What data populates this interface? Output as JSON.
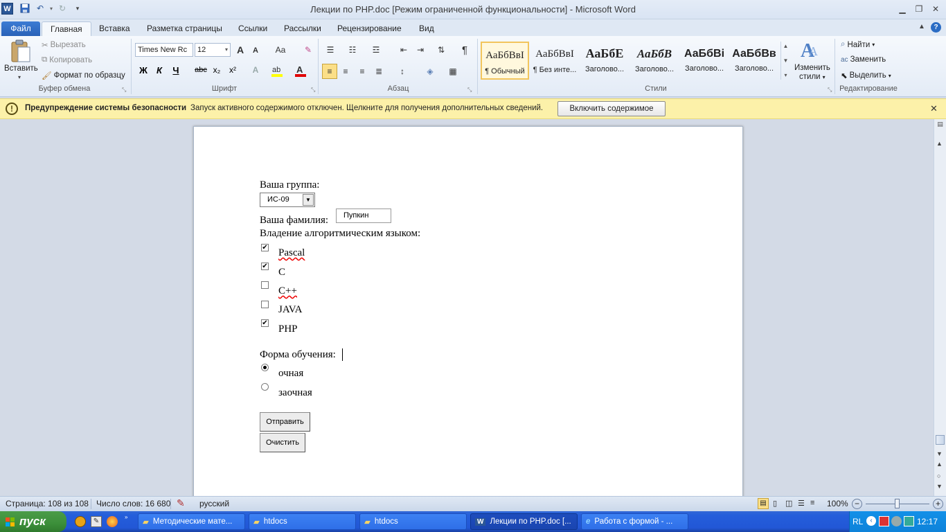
{
  "window": {
    "title": "Лекции по PHP.doc [Режим ограниченной функциональности]  -  Microsoft Word",
    "word_icon": "W"
  },
  "tabs": {
    "file": "Файл",
    "items": [
      "Главная",
      "Вставка",
      "Разметка страницы",
      "Ссылки",
      "Рассылки",
      "Рецензирование",
      "Вид"
    ]
  },
  "ribbon": {
    "clipboard": {
      "paste": "Вставить",
      "cut": "Вырезать",
      "copy": "Копировать",
      "format_painter": "Формат по образцу",
      "label": "Буфер обмена"
    },
    "font": {
      "name": "Times New Rc",
      "size": "12",
      "label": "Шрифт",
      "bold": "Ж",
      "italic": "К",
      "underline": "Ч",
      "strike": "abc",
      "sub": "x₂",
      "sup": "x²",
      "grow": "A",
      "shrink": "A",
      "case": "Aa"
    },
    "paragraph": {
      "label": "Абзац",
      "pilcrow": "¶"
    },
    "styles": {
      "label": "Стили",
      "items": [
        {
          "sample": "АаБбВвІ",
          "name": "¶ Обычный"
        },
        {
          "sample": "АаБбВвІ",
          "name": "¶ Без инте..."
        },
        {
          "sample": "АаБбЕ",
          "name": "Заголово..."
        },
        {
          "sample": "АаБбВ",
          "name": "Заголово..."
        },
        {
          "sample": "АаБбВі",
          "name": "Заголово..."
        },
        {
          "sample": "АаБбВв",
          "name": "Заголово..."
        }
      ],
      "change": "Изменить",
      "change2": "стили"
    },
    "editing": {
      "find": "Найти",
      "replace": "Заменить",
      "select": "Выделить",
      "label": "Редактирование"
    }
  },
  "security": {
    "title": "Предупреждение системы безопасности",
    "message": "Запуск активного содержимого отключен. Щелкните для получения дополнительных сведений.",
    "button": "Включить содержимое"
  },
  "document": {
    "group_label": "Ваша группа:",
    "group_value": "ИС-09",
    "surname_label": "Ваша фамилия:",
    "surname_value": "Пупкин",
    "lang_label": "Владение алгоритмическим языком:",
    "languages": [
      {
        "name": "Pascal",
        "checked": "✔"
      },
      {
        "name": "C",
        "checked": "✔"
      },
      {
        "name": "C++",
        "checked": ""
      },
      {
        "name": "JAVA",
        "checked": ""
      },
      {
        "name": "PHP",
        "checked": "✔"
      }
    ],
    "form_label": "Форма обучения:",
    "forms": [
      {
        "name": "очная",
        "selected": true
      },
      {
        "name": "заочная",
        "selected": false
      }
    ],
    "submit": "Отправить",
    "reset": "Очистить"
  },
  "status": {
    "page": "Страница: 108 из 108",
    "words": "Число слов: 16 680",
    "language": "русский",
    "zoom": "100%"
  },
  "taskbar": {
    "start": "пуск",
    "tasks": [
      "Методические мате...",
      "htdocs",
      "htdocs",
      "Лекции по PHP.doc [...",
      "Работа с формой - ..."
    ],
    "lang": "RL",
    "clock": "12:17"
  }
}
